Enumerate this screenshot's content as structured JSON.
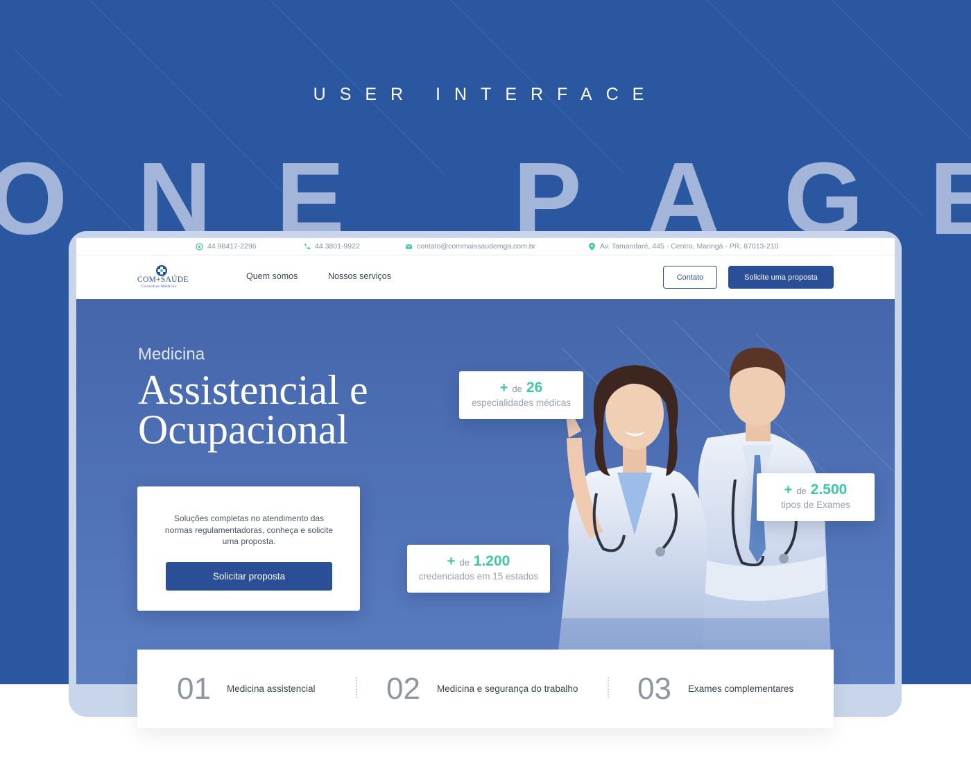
{
  "showcase": {
    "kicker": "USER INTERFACE",
    "title_letters": [
      "O",
      "N",
      "E",
      "P",
      "A",
      "G",
      "E"
    ]
  },
  "colors": {
    "backdrop": "#2b56a0",
    "primary": "#2a4f97",
    "accent": "#3ec7a5",
    "hero": "#4f70b5"
  },
  "topbar": {
    "whatsapp": {
      "icon": "whatsapp-icon",
      "text": "44 98417-2296"
    },
    "phone": {
      "icon": "phone-icon",
      "text": "44 3801-9922"
    },
    "email": {
      "icon": "mail-icon",
      "text": "contato@commaissaudemga.com.br"
    },
    "address": {
      "icon": "location-pin-icon",
      "text": "Av. Tamandaré, 445 - Centro, Maringá - PR, 87013-210"
    }
  },
  "nav": {
    "logo_text": "COM+SAÚDE",
    "logo_subtext": "Consultas Médicas",
    "links": [
      "Quem somos",
      "Nossos serviços"
    ],
    "contact_button": "Contato",
    "proposal_button": "Solicite uma proposta"
  },
  "hero": {
    "eyebrow": "Medicina",
    "headline": "Assistencial e Ocupacional",
    "cta_text": "Soluções completas no atendimento das normas regulamentadoras, conheça e solicite uma proposta.",
    "cta_button": "Solicitar proposta"
  },
  "stats": [
    {
      "plus": "+",
      "prefix": "de",
      "value": "26",
      "label": "especialidades médicas"
    },
    {
      "plus": "+",
      "prefix": "de",
      "value": "2.500",
      "label": "tipos de Exames"
    },
    {
      "plus": "+",
      "prefix": "de",
      "value": "1.200",
      "label": "credenciados em 15 estados"
    }
  ],
  "features": [
    {
      "number": "01",
      "label": "Medicina assistencial"
    },
    {
      "number": "02",
      "label": "Medicina e segurança do trabalho"
    },
    {
      "number": "03",
      "label": "Exames complementares"
    }
  ]
}
